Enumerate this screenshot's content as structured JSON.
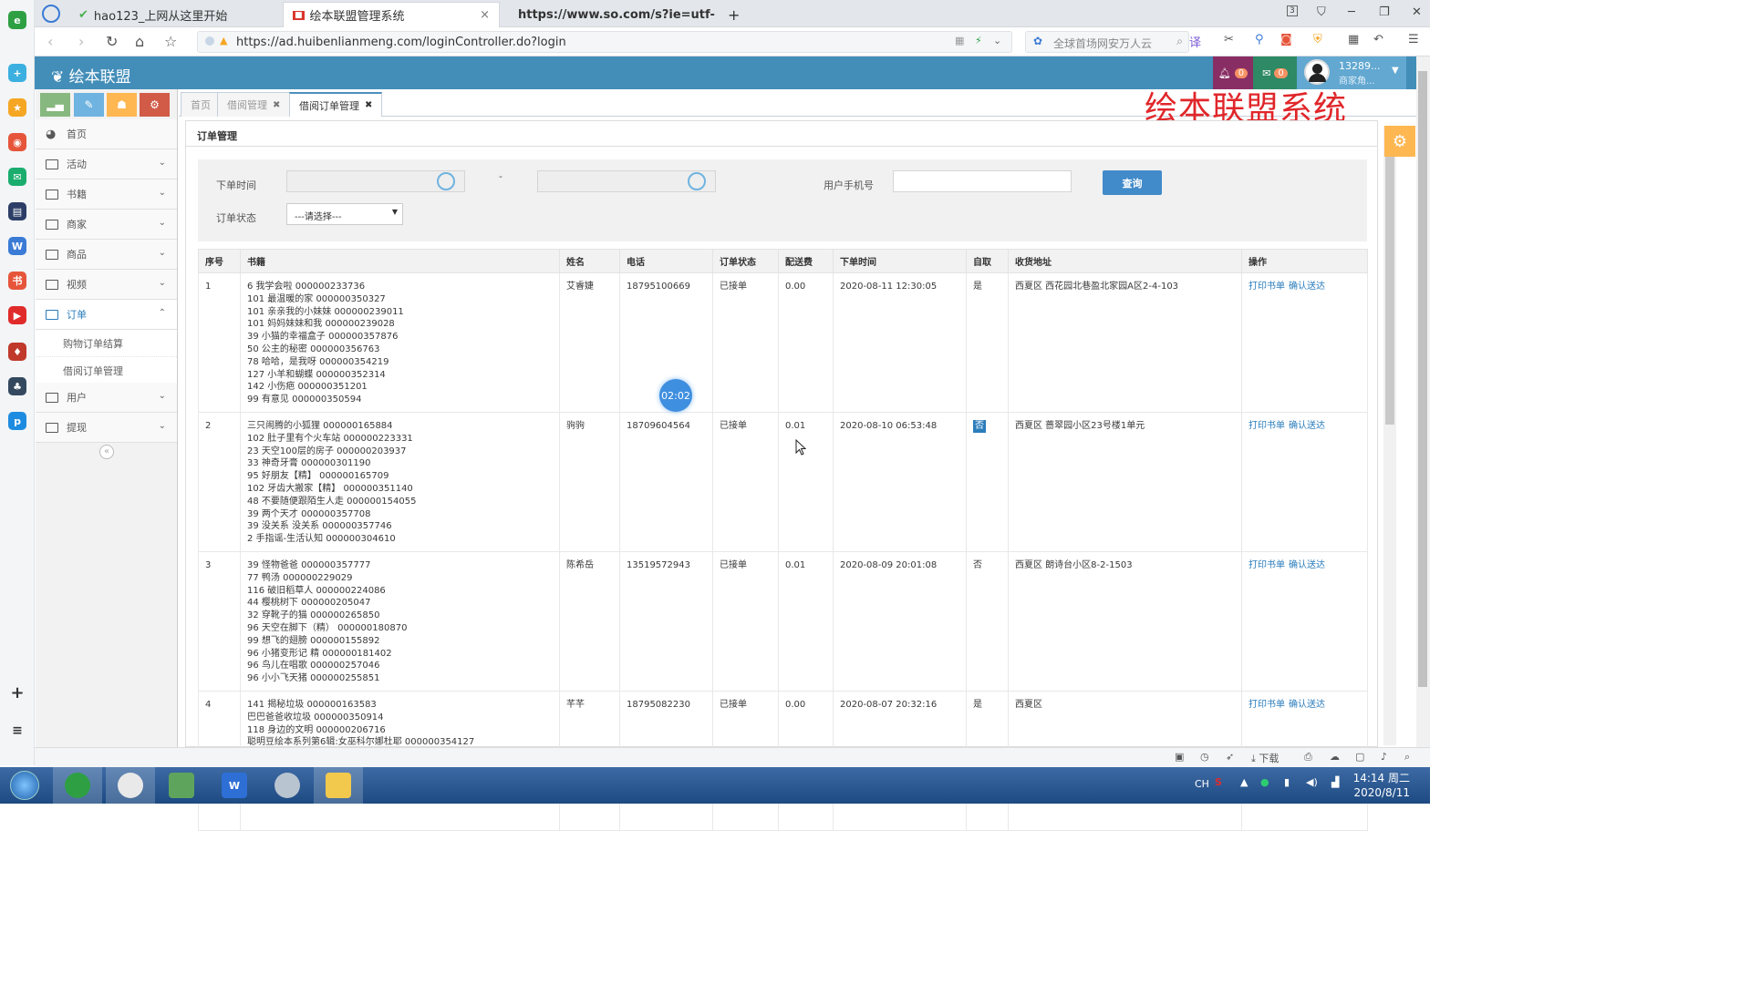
{
  "browser": {
    "tabs": [
      "hao123_上网从这里开始",
      "绘本联盟管理系统",
      "https://www.so.com/s?ie=utf-"
    ],
    "tab_close": "×",
    "new_tab": "+",
    "win_count": "3",
    "url": "https://ad.huibenlianmeng.com/loginController.do?login",
    "search_placeholder": "全球首场网安万人云"
  },
  "app": {
    "logo": "绘本联盟",
    "bell_count": "0",
    "mail_count": "0",
    "user_name": "13289...",
    "user_role": "商家角..."
  },
  "watermark": "绘本联盟系统",
  "sidebar": {
    "items": [
      {
        "label": "首页"
      },
      {
        "label": "活动"
      },
      {
        "label": "书籍"
      },
      {
        "label": "商家"
      },
      {
        "label": "商品"
      },
      {
        "label": "视频"
      },
      {
        "label": "订单"
      },
      {
        "label": "用户"
      },
      {
        "label": "提现"
      }
    ],
    "sub_items": [
      "购物订单结算",
      "借阅订单管理"
    ],
    "collapse": "«"
  },
  "content_tabs": [
    {
      "label": "首页"
    },
    {
      "label": "借阅管理"
    },
    {
      "label": "借阅订单管理"
    }
  ],
  "panel": {
    "title": "订单管理",
    "filter": {
      "order_time_label": "下单时间",
      "dash": "-",
      "phone_label": "用户手机号",
      "status_label": "订单状态",
      "status_value": "---请选择---",
      "query_button": "查询"
    }
  },
  "table": {
    "headers": [
      "序号",
      "书籍",
      "姓名",
      "电话",
      "订单状态",
      "配送费",
      "下单时间",
      "自取",
      "收货地址",
      "操作"
    ],
    "op_print": "打印书单",
    "op_confirm": "确认送达",
    "rows": [
      {
        "no": "1",
        "books": [
          "6 我学会啦 000000233736",
          "101 最温暖的家 000000350327",
          "101 亲亲我的小妹妹 000000239011",
          "101 妈妈妹妹和我 000000239028",
          "39 小猫的幸福盒子 000000357876",
          "50 公主的秘密 000000356763",
          "78 哈哈，是我呀 000000354219",
          "127 小羊和蝴蝶 000000352314",
          "142 小伤疤 000000351201",
          "99 有意见 000000350594"
        ],
        "name": "艾睿婕",
        "phone": "18795100669",
        "status": "已接单",
        "fee": "0.00",
        "time": "2020-08-11 12:30:05",
        "self": "是",
        "address": "西夏区 西花园北巷盈北家园A区2-4-103"
      },
      {
        "no": "2",
        "books": [
          "三只闹腾的小狐狸 000000165884",
          "102 肚子里有个火车站 000000223331",
          "23 天空100层的房子 000000203937",
          "33 神奇牙膏 000000301190",
          "95 好朋友【精】 000000165709",
          "102 牙齿大搬家【精】 000000351140",
          "48 不要随便跟陌生人走 000000154055",
          "39 两个天才 000000357708",
          "39 没关系 没关系 000000357746",
          "2 手指谣-生活认知 000000304610"
        ],
        "name": "驹驹",
        "phone": "18709604564",
        "status": "已接单",
        "fee": "0.01",
        "time": "2020-08-10 06:53:48",
        "self": "否",
        "address": "西夏区 蔷翠园小区23号楼1单元"
      },
      {
        "no": "3",
        "books": [
          "39 怪物爸爸 000000357777",
          "77 鸭汤 000000229029",
          "116 破旧稻草人 000000224086",
          "44 樱桃树下 000000205047",
          "32 穿靴子的猫 000000265850",
          "96 天空在脚下（精） 000000180870",
          "99 想飞的翅膀 000000155892",
          "96 小猪变形记 精 000000181402",
          "96 鸟儿在唱歌 000000257046",
          "96 小小飞天猪 000000255851"
        ],
        "name": "陈希岳",
        "phone": "13519572943",
        "status": "已接单",
        "fee": "0.01",
        "time": "2020-08-09 20:01:08",
        "self": "否",
        "address": "西夏区 朗诗台小区8-2-1503"
      },
      {
        "no": "4",
        "books": [
          "141 揭秘垃圾 000000163583",
          "巴巴爸爸收垃圾 000000350914",
          "118 身边的文明 000000206716",
          "聪明豆绘本系列第6辑:女巫科尔娜杜耶 000000354127"
        ],
        "name": "芊芊",
        "phone": "18795082230",
        "status": "已接单",
        "fee": "0.00",
        "time": "2020-08-07 20:32:16",
        "self": "是",
        "address": "西夏区"
      }
    ]
  },
  "overlay": {
    "timer": "02:02"
  },
  "statusbar": {
    "download": "下载"
  },
  "taskbar": {
    "lang": "CH",
    "time": "14:14 周二",
    "date": "2020/8/11"
  },
  "colors": {
    "header": "#438eb9",
    "accent": "#2b7dbc",
    "watermark": "#e0262a",
    "query": "#428bca"
  }
}
